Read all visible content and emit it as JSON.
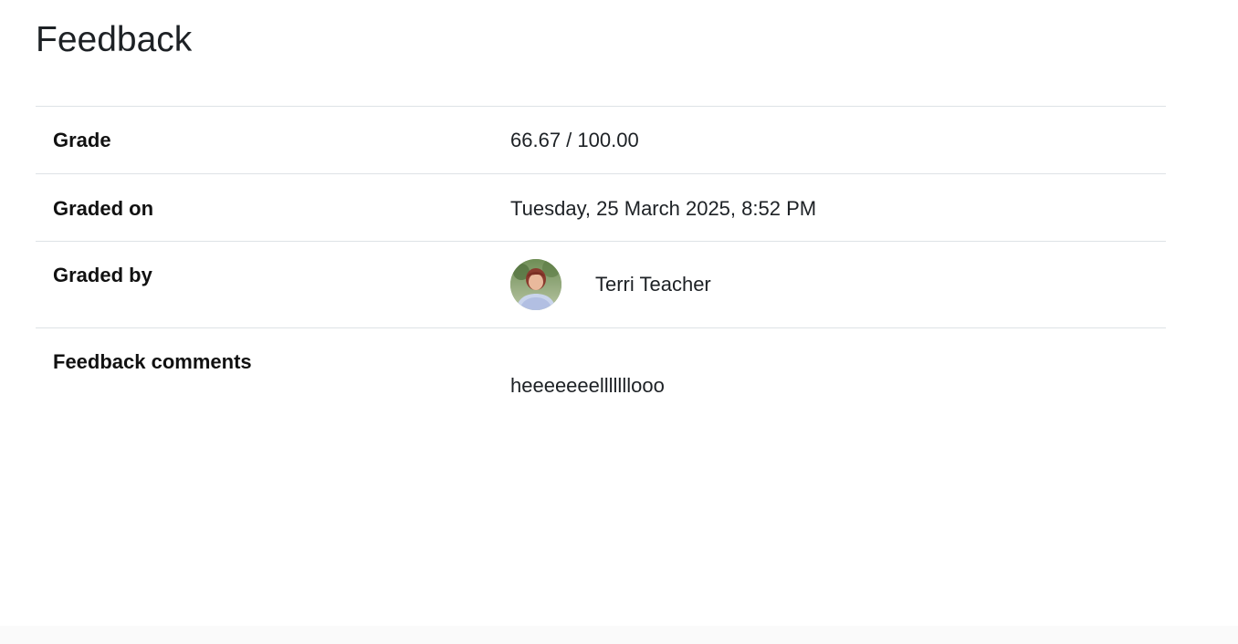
{
  "page": {
    "title": "Feedback"
  },
  "feedback": {
    "grade_label": "Grade",
    "grade_value": "66.67 / 100.00",
    "graded_on_label": "Graded on",
    "graded_on_value": "Tuesday, 25 March 2025, 8:52 PM",
    "graded_by_label": "Graded by",
    "graded_by_name": "Terri Teacher",
    "comments_label": "Feedback comments",
    "comments_value": "heeeeeeelllllllooo"
  }
}
